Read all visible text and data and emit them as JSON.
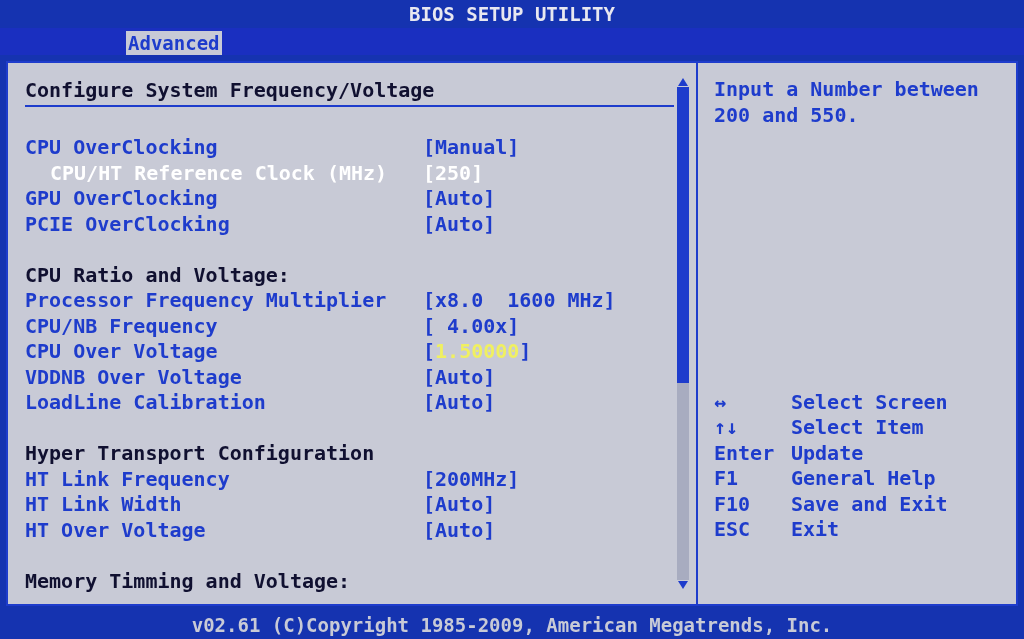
{
  "window": {
    "title": "BIOS SETUP UTILITY"
  },
  "tabs": [
    {
      "label": "Advanced",
      "selected": true
    }
  ],
  "panel": {
    "title": "Configure System Frequency/Voltage",
    "items": [
      {
        "kind": "gap"
      },
      {
        "kind": "setting",
        "label": "CPU OverClocking",
        "value": "[Manual]",
        "selected": false,
        "editing": false,
        "children": [
          {
            "kind": "setting",
            "label": "CPU/HT Reference Clock (MHz)",
            "value": "[250]",
            "selected": true,
            "editing": false
          }
        ]
      },
      {
        "kind": "setting",
        "label": "GPU OverClocking",
        "value": "[Auto]",
        "selected": false,
        "editing": false
      },
      {
        "kind": "setting",
        "label": "PCIE OverClocking",
        "value": "[Auto]",
        "selected": false,
        "editing": false
      },
      {
        "kind": "gap"
      },
      {
        "kind": "heading",
        "label": "CPU Ratio and Voltage:"
      },
      {
        "kind": "setting",
        "label": "Processor Frequency Multiplier",
        "value": "[x8.0  1600 MHz]",
        "selected": false,
        "editing": false
      },
      {
        "kind": "setting",
        "label": "CPU/NB Frequency",
        "value": "[ 4.00x]",
        "selected": false,
        "editing": false
      },
      {
        "kind": "setting",
        "label": "CPU Over Voltage",
        "value": "[1.50000]",
        "selected": false,
        "editing": true
      },
      {
        "kind": "setting",
        "label": "VDDNB Over Voltage",
        "value": "[Auto]",
        "selected": false,
        "editing": false
      },
      {
        "kind": "setting",
        "label": "LoadLine Calibration",
        "value": "[Auto]",
        "selected": false,
        "editing": false
      },
      {
        "kind": "gap"
      },
      {
        "kind": "heading",
        "label": "Hyper Transport Configuration"
      },
      {
        "kind": "setting",
        "label": "HT Link Frequency",
        "value": "[200MHz]",
        "selected": false,
        "editing": false
      },
      {
        "kind": "setting",
        "label": "HT Link Width",
        "value": "[Auto]",
        "selected": false,
        "editing": false
      },
      {
        "kind": "setting",
        "label": "HT Over Voltage",
        "value": "[Auto]",
        "selected": false,
        "editing": false
      },
      {
        "kind": "gap"
      },
      {
        "kind": "heading",
        "label": "Memory Timming and Voltage:"
      }
    ]
  },
  "help": {
    "text": "Input a Number between 200 and 550.",
    "keys": [
      {
        "key": "↔",
        "action": "Select Screen"
      },
      {
        "key": "↑↓",
        "action": "Select Item"
      },
      {
        "key": "Enter",
        "action": "Update"
      },
      {
        "key": "F1",
        "action": "General Help"
      },
      {
        "key": "F10",
        "action": "Save and Exit"
      },
      {
        "key": "ESC",
        "action": "Exit"
      }
    ]
  },
  "status_bar": "v02.61 (C)Copyright 1985-2009, American Megatrends, Inc."
}
